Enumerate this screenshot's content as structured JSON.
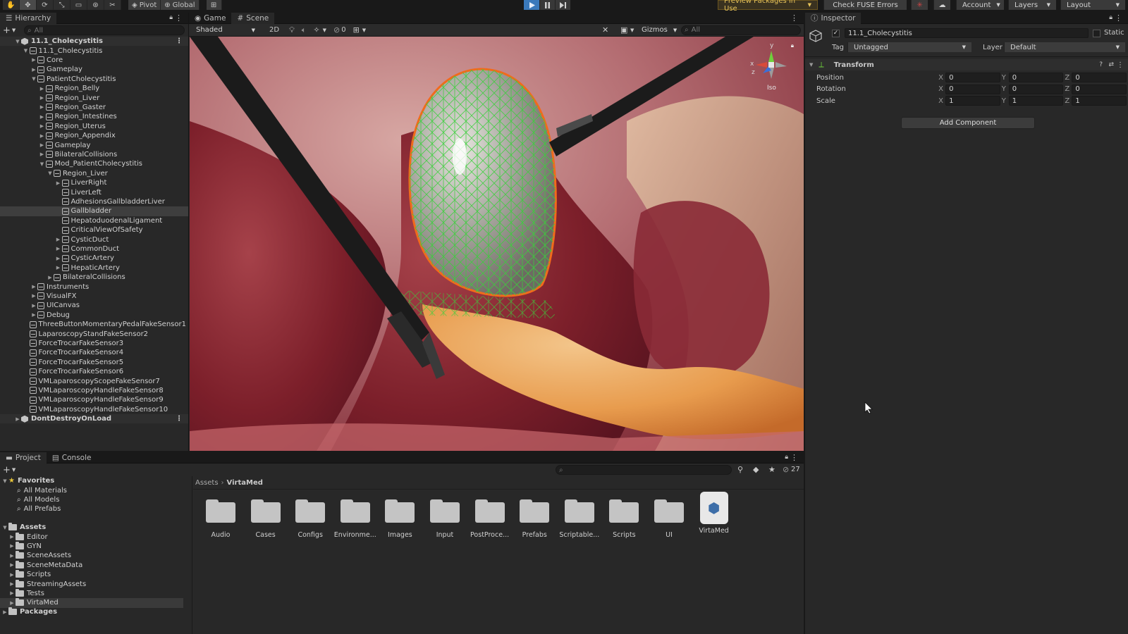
{
  "toolbar": {
    "pivot_label": "Pivot",
    "global_label": "Global",
    "preview_packages_label": "Preview Packages in Use",
    "check_fuse_label": "Check FUSE Errors",
    "account_label": "Account",
    "layers_label": "Layers",
    "layout_label": "Layout"
  },
  "hierarchy": {
    "tab_label": "Hierarchy",
    "search_placeholder": "All",
    "items": [
      {
        "label": "11.1_Cholecystitis"
      },
      {
        "label": "11.1_Cholecystitis"
      },
      {
        "label": "Core"
      },
      {
        "label": "Gameplay"
      },
      {
        "label": "PatientCholecystitis"
      },
      {
        "label": "Region_Belly"
      },
      {
        "label": "Region_Liver"
      },
      {
        "label": "Region_Gaster"
      },
      {
        "label": "Region_Intestines"
      },
      {
        "label": "Region_Uterus"
      },
      {
        "label": "Region_Appendix"
      },
      {
        "label": "Gameplay"
      },
      {
        "label": "BilateralCollisions"
      },
      {
        "label": "Mod_PatientCholecystitis"
      },
      {
        "label": "Region_Liver"
      },
      {
        "label": "LiverRight"
      },
      {
        "label": "LiverLeft"
      },
      {
        "label": "AdhesionsGallbladderLiver"
      },
      {
        "label": "Gallbladder"
      },
      {
        "label": "HepatoduodenalLigament"
      },
      {
        "label": "CriticalViewOfSafety"
      },
      {
        "label": "CysticDuct"
      },
      {
        "label": "CommonDuct"
      },
      {
        "label": "CysticArtery"
      },
      {
        "label": "HepaticArtery"
      },
      {
        "label": "BilateralCollisions"
      },
      {
        "label": "Instruments"
      },
      {
        "label": "VisualFX"
      },
      {
        "label": "UICanvas"
      },
      {
        "label": "Debug"
      },
      {
        "label": "ThreeButtonMomentaryPedalFakeSensor1"
      },
      {
        "label": "LaparoscopyStandFakeSensor2"
      },
      {
        "label": "ForceTrocarFakeSensor3"
      },
      {
        "label": "ForceTrocarFakeSensor4"
      },
      {
        "label": "ForceTrocarFakeSensor5"
      },
      {
        "label": "ForceTrocarFakeSensor6"
      },
      {
        "label": "VMLaparoscopyScopeFakeSensor7"
      },
      {
        "label": "VMLaparoscopyHandleFakeSensor8"
      },
      {
        "label": "VMLaparoscopyHandleFakeSensor9"
      },
      {
        "label": "VMLaparoscopyHandleFakeSensor10"
      },
      {
        "label": "DontDestroyOnLoad"
      }
    ]
  },
  "scene": {
    "game_tab": "Game",
    "scene_tab": "Scene",
    "shading_mode": "Shaded",
    "mode_2d": "2D",
    "hidden_count": "0",
    "gizmos_label": "Gizmos",
    "search_placeholder": "All",
    "iso_label": "Iso",
    "axis_x": "x",
    "axis_y": "y",
    "axis_z": "z"
  },
  "inspector": {
    "tab_label": "Inspector",
    "object_name": "11.1_Cholecystitis",
    "static_label": "Static",
    "tag_label": "Tag",
    "tag_value": "Untagged",
    "layer_label": "Layer",
    "layer_value": "Default",
    "component_title": "Transform",
    "position_label": "Position",
    "rotation_label": "Rotation",
    "scale_label": "Scale",
    "x_label": "X",
    "y_label": "Y",
    "z_label": "Z",
    "position": {
      "x": "0",
      "y": "0",
      "z": "0"
    },
    "rotation": {
      "x": "0",
      "y": "0",
      "z": "0"
    },
    "scale": {
      "x": "1",
      "y": "1",
      "z": "1"
    },
    "add_component_label": "Add Component"
  },
  "project": {
    "project_tab": "Project",
    "console_tab": "Console",
    "hidden_count": "27",
    "favorites_label": "Favorites",
    "favorites": [
      {
        "label": "All Materials"
      },
      {
        "label": "All Models"
      },
      {
        "label": "All Prefabs"
      }
    ],
    "assets_label": "Assets",
    "asset_folders": [
      {
        "label": "Editor"
      },
      {
        "label": "GYN"
      },
      {
        "label": "SceneAssets"
      },
      {
        "label": "SceneMetaData"
      },
      {
        "label": "Scripts"
      },
      {
        "label": "StreamingAssets"
      },
      {
        "label": "Tests"
      },
      {
        "label": "VirtaMed"
      }
    ],
    "packages_label": "Packages",
    "breadcrumb_root": "Assets",
    "breadcrumb_current": "VirtaMed",
    "grid_items": [
      {
        "label": "Audio"
      },
      {
        "label": "Cases"
      },
      {
        "label": "Configs"
      },
      {
        "label": "Environme..."
      },
      {
        "label": "Images"
      },
      {
        "label": "Input"
      },
      {
        "label": "PostProce..."
      },
      {
        "label": "Prefabs"
      },
      {
        "label": "Scriptable..."
      },
      {
        "label": "Scripts"
      },
      {
        "label": "UI"
      },
      {
        "label": "VirtaMed"
      }
    ]
  }
}
